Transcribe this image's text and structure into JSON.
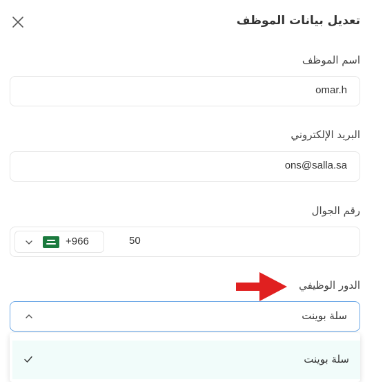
{
  "dialog": {
    "title": "تعديل بيانات الموظف"
  },
  "fields": {
    "name": {
      "label": "اسم الموظف",
      "value": "omar.h"
    },
    "email": {
      "label": "البريد الإلكتروني",
      "value": "ons@salla.sa"
    },
    "phone": {
      "label": "رقم الجوال",
      "value": "50",
      "country_code": "+966",
      "country_flag": "saudi-arabia-flag"
    },
    "role": {
      "label": "الدور الوظيفي",
      "value": "سلة بوينت",
      "options": [
        {
          "label": "سلة بوينت",
          "selected": true
        }
      ]
    }
  },
  "colors": {
    "focus_border": "#6da8e6",
    "selected_option_bg": "#f1fcfa",
    "annotation_arrow": "#e02020",
    "flag_green": "#1b7a3e"
  },
  "icons": {
    "close": "close-icon",
    "country_chevron": "chevron-down-icon",
    "select_chevron": "chevron-up-icon",
    "check": "check-icon",
    "annotation": "arrow-right-icon"
  }
}
